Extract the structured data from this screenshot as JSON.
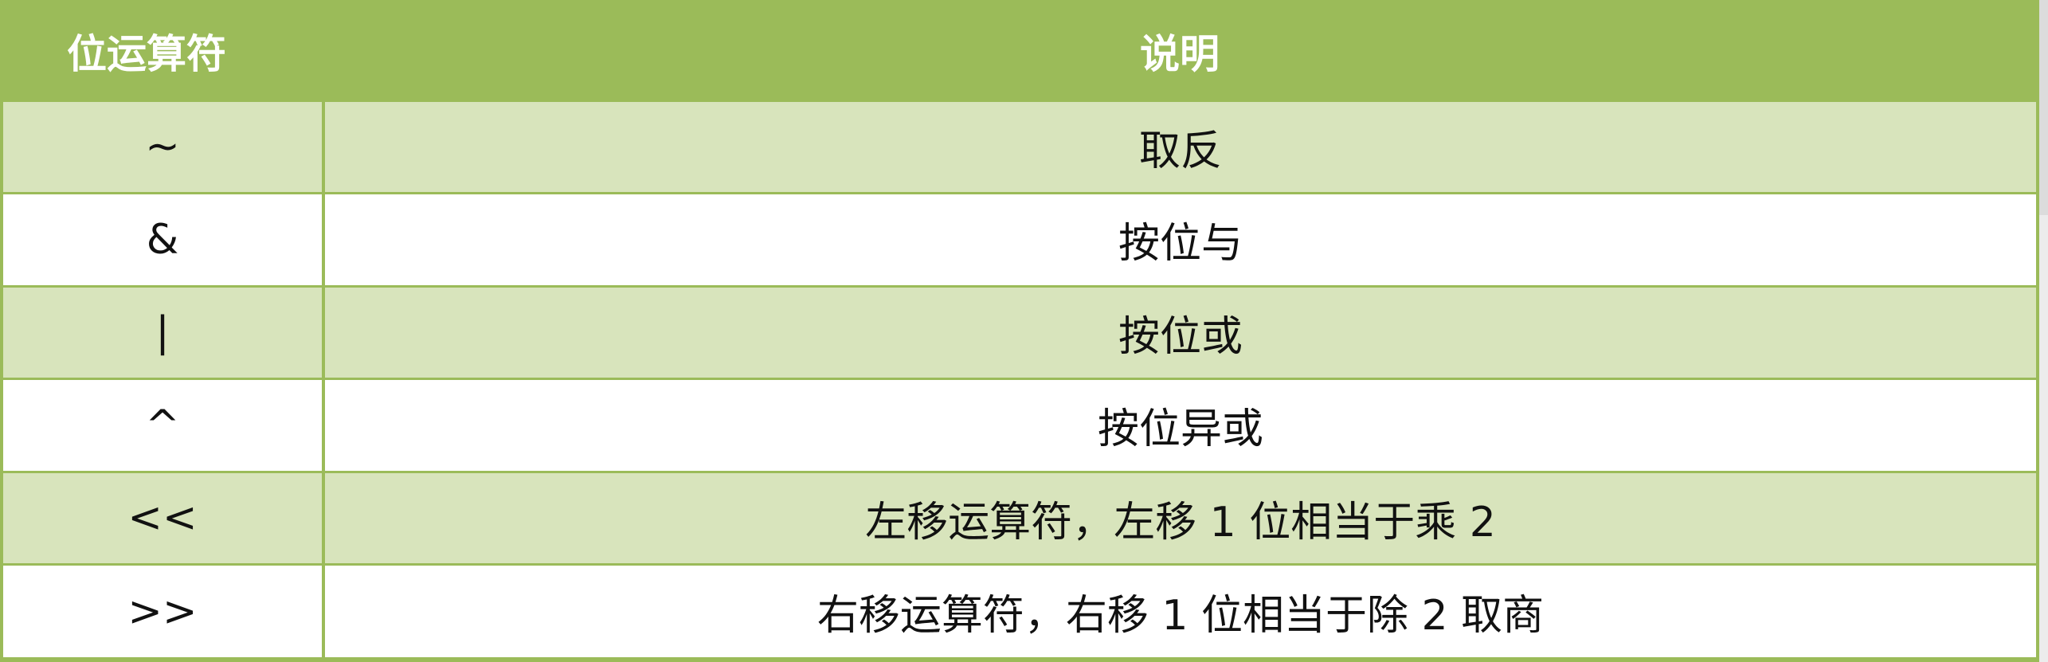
{
  "table": {
    "headers": {
      "operator": "位运算符",
      "description": "说明"
    },
    "rows": [
      {
        "operator": "~",
        "description": "取反"
      },
      {
        "operator": "&",
        "description": "按位与"
      },
      {
        "operator": "|",
        "description": "按位或"
      },
      {
        "operator": "^",
        "description": "按位异或"
      },
      {
        "operator": "<<",
        "description": "左移运算符，左移 1 位相当于乘 2"
      },
      {
        "operator": ">>",
        "description": "右移运算符，右移 1 位相当于除 2 取商"
      }
    ]
  },
  "colors": {
    "header_bg": "#9bbb59",
    "band_bg": "#d8e4bc",
    "row_bg": "#ffffff",
    "header_text": "#ffffff"
  }
}
